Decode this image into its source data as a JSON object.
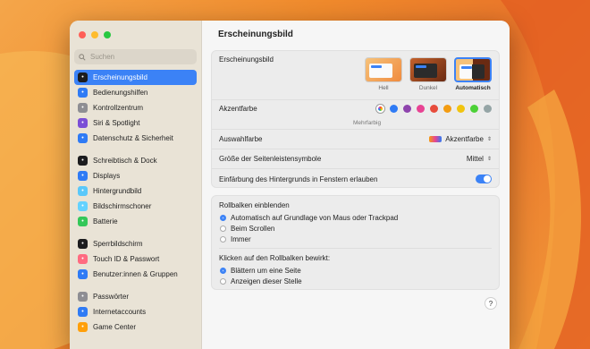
{
  "window_title": "Erscheinungsbild",
  "search": {
    "placeholder": "Suchen"
  },
  "sidebar": {
    "items": [
      {
        "label": "Erscheinungsbild",
        "icon": "appearance-icon",
        "color": "#1c1c1e",
        "active": true
      },
      {
        "label": "Bedienungshilfen",
        "icon": "accessibility-icon",
        "color": "#2f7bf5"
      },
      {
        "label": "Kontrollzentrum",
        "icon": "control-center-icon",
        "color": "#8e8e93"
      },
      {
        "label": "Siri & Spotlight",
        "icon": "siri-icon",
        "color": "#7b4fd6"
      },
      {
        "label": "Datenschutz & Sicherheit",
        "icon": "privacy-hand-icon",
        "color": "#2f7bf5"
      },
      {
        "label": "Schreibtisch & Dock",
        "icon": "dock-icon",
        "color": "#1c1c1e"
      },
      {
        "label": "Displays",
        "icon": "display-icon",
        "color": "#2f7bf5"
      },
      {
        "label": "Hintergrundbild",
        "icon": "wallpaper-icon",
        "color": "#5ac8fa"
      },
      {
        "label": "Bildschirmschoner",
        "icon": "screensaver-icon",
        "color": "#64d2ff"
      },
      {
        "label": "Batterie",
        "icon": "battery-icon",
        "color": "#34c759"
      },
      {
        "label": "Sperrbildschirm",
        "icon": "lock-screen-icon",
        "color": "#1c1c1e"
      },
      {
        "label": "Touch ID & Passwort",
        "icon": "touch-id-icon",
        "color": "#ff6b81"
      },
      {
        "label": "Benutzer:innen & Gruppen",
        "icon": "users-icon",
        "color": "#2f7bf5"
      },
      {
        "label": "Passwörter",
        "icon": "key-icon",
        "color": "#8e8e93"
      },
      {
        "label": "Internetaccounts",
        "icon": "at-icon",
        "color": "#2f7bf5"
      },
      {
        "label": "Game Center",
        "icon": "game-center-icon",
        "color": "#ff9f0a"
      }
    ]
  },
  "appearance": {
    "label": "Erscheinungsbild",
    "options": [
      {
        "label": "Hell"
      },
      {
        "label": "Dunkel"
      },
      {
        "label": "Automatisch",
        "selected": true
      }
    ]
  },
  "accent": {
    "label": "Akzentfarbe",
    "caption": "Mehrfarbig",
    "colors": [
      "#2f7bf5",
      "#8e44ad",
      "#e84393",
      "#e74c3c",
      "#f39c12",
      "#f1c40f",
      "#4cd137",
      "#95a5a6"
    ]
  },
  "highlight": {
    "label": "Auswahlfarbe",
    "value": "Akzentfarbe"
  },
  "sidebar_size": {
    "label": "Größe der Seitenleistensymbole",
    "value": "Mittel"
  },
  "tinting": {
    "label": "Einfärbung des Hintergrunds in Fenstern erlauben",
    "enabled": true
  },
  "scrollbars": {
    "label": "Rollbalken einblenden",
    "options": [
      "Automatisch auf Grundlage von Maus oder Trackpad",
      "Beim Scrollen",
      "Immer"
    ],
    "selected": 0
  },
  "click_scroll": {
    "label": "Klicken auf den Rollbalken bewirkt:",
    "options": [
      "Blättern um eine Seite",
      "Anzeigen dieser Stelle"
    ],
    "selected": 0
  },
  "help": "?"
}
